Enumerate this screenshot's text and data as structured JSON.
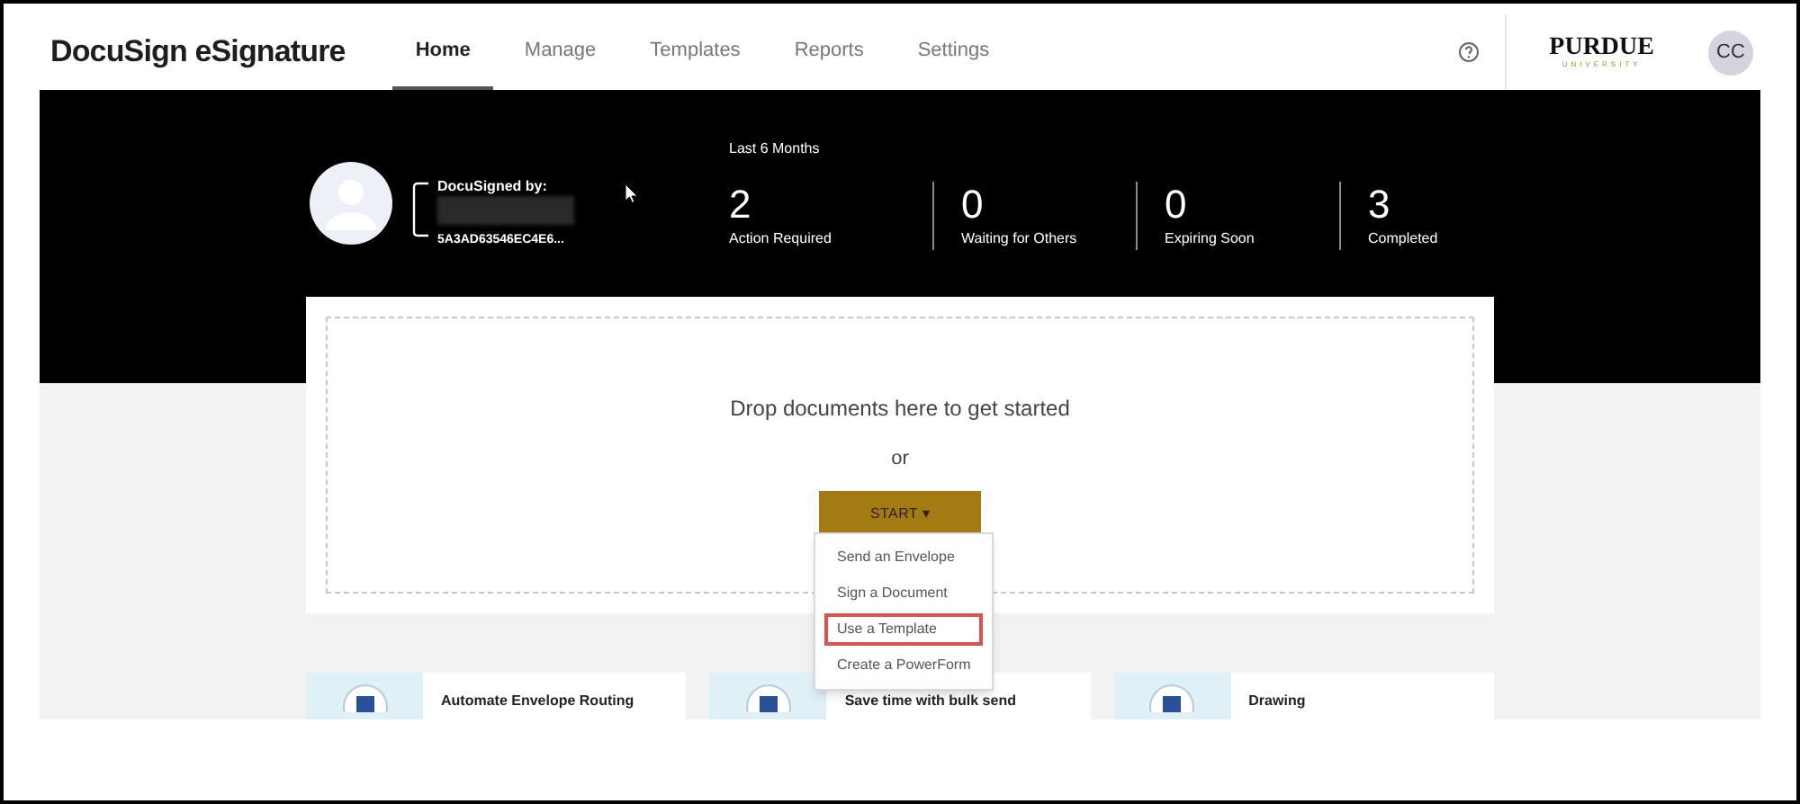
{
  "header": {
    "logo": "DocuSign eSignature",
    "tabs": [
      {
        "label": "Home",
        "selected": true
      },
      {
        "label": "Manage",
        "selected": false
      },
      {
        "label": "Templates",
        "selected": false
      },
      {
        "label": "Reports",
        "selected": false
      },
      {
        "label": "Settings",
        "selected": false
      }
    ],
    "org_logo": {
      "name": "PURDUE",
      "subtitle": "UNIVERSITY"
    },
    "user_initials": "CC"
  },
  "hero": {
    "signature": {
      "label": "DocuSigned by:",
      "id": "5A3AD63546EC4E6..."
    },
    "period": "Last 6 Months",
    "stats": [
      {
        "value": "2",
        "label": "Action Required"
      },
      {
        "value": "0",
        "label": "Waiting for Others"
      },
      {
        "value": "0",
        "label": "Expiring Soon"
      },
      {
        "value": "3",
        "label": "Completed"
      }
    ]
  },
  "dropzone": {
    "message": "Drop documents here to get started",
    "or": "or",
    "start_button": "START ▾"
  },
  "start_menu": [
    {
      "label": "Send an Envelope",
      "selected": false
    },
    {
      "label": "Sign a Document",
      "selected": false
    },
    {
      "label": "Use a Template",
      "selected": true
    },
    {
      "label": "Create a PowerForm",
      "selected": false
    }
  ],
  "cards": [
    {
      "title": "Automate Envelope Routing"
    },
    {
      "title": "Save time with bulk send"
    },
    {
      "title": "Drawing"
    }
  ]
}
